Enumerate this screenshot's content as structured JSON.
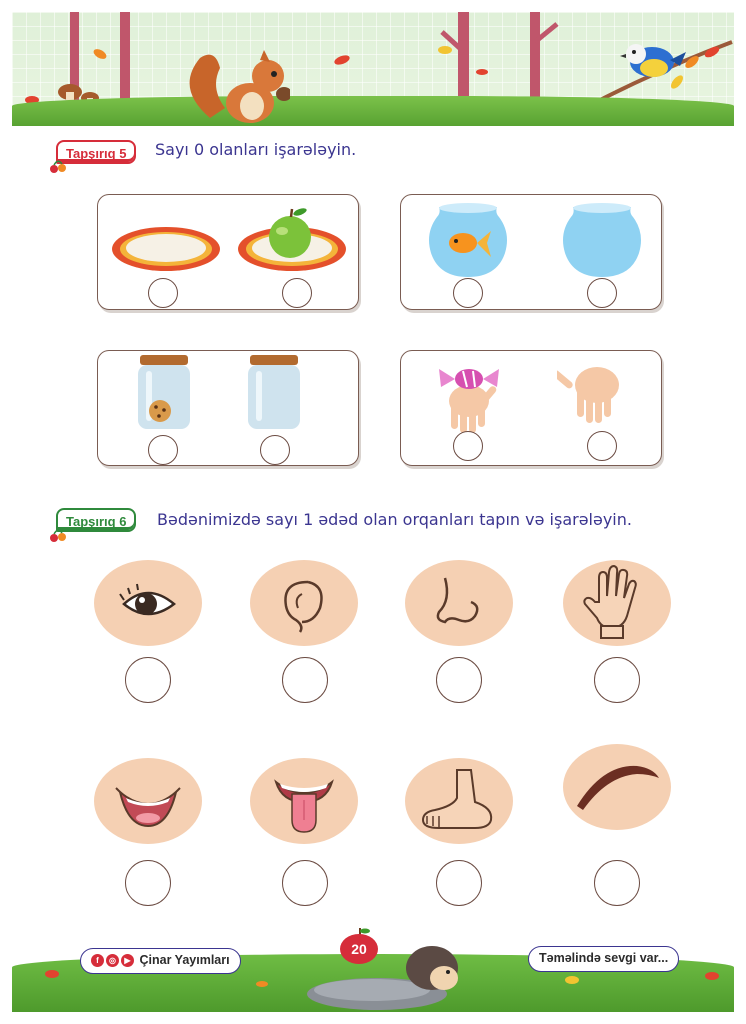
{
  "task5": {
    "tag": "Tapşırıq 5",
    "instruction": "Sayı 0 olanları işarələyin."
  },
  "task6": {
    "tag": "Tapşırıq 6",
    "instruction": "Bədənimizdə sayı 1 ədəd olan orqanları tapın və işarələyin."
  },
  "footer": {
    "publisher": "Çinar Yayımları",
    "page_number": "20",
    "slogan": "Təməlində sevgi var..."
  },
  "icons": [
    "squirrel-icon",
    "bird-icon",
    "plate-icon",
    "apple-icon",
    "fishbowl-icon",
    "goldfish-icon",
    "jar-icon",
    "cookie-icon",
    "hand-icon",
    "candy-icon",
    "eye-icon",
    "ear-icon",
    "nose-icon",
    "mouth-icon",
    "tongue-icon",
    "foot-icon",
    "eyebrow-icon",
    "hedgehog-icon",
    "facebook-icon",
    "instagram-icon",
    "youtube-icon"
  ],
  "colors": {
    "accent_red": "#d62d3a",
    "accent_green": "#2f8a3c",
    "text_blue": "#3b3590",
    "skin": "#f5d0b3"
  }
}
